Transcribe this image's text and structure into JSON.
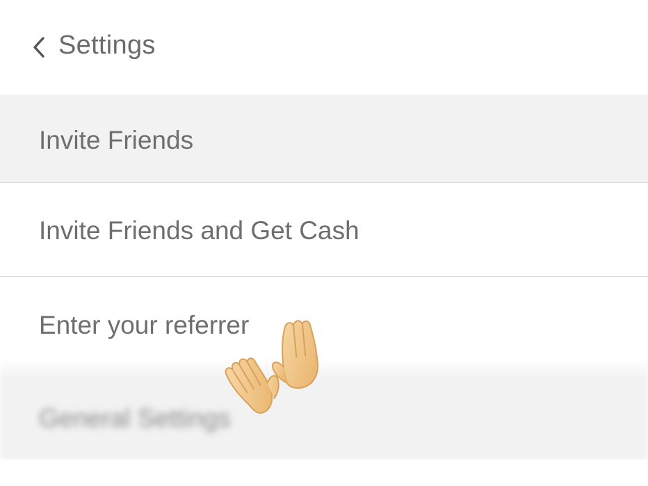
{
  "header": {
    "back_icon": "chevron-left-icon",
    "title": "Settings"
  },
  "sections": {
    "invite_header": "Invite Friends",
    "items": [
      {
        "label": "Invite Friends and Get Cash"
      },
      {
        "label": "Enter your referrer"
      }
    ],
    "general_header": "General Settings"
  },
  "overlay": {
    "emoji": "raising-hands-icon"
  },
  "colors": {
    "text": "#6e6e6e",
    "section_bg": "#f2f2f2",
    "divider": "#dcdcdc",
    "skin": "#f3c98f"
  }
}
